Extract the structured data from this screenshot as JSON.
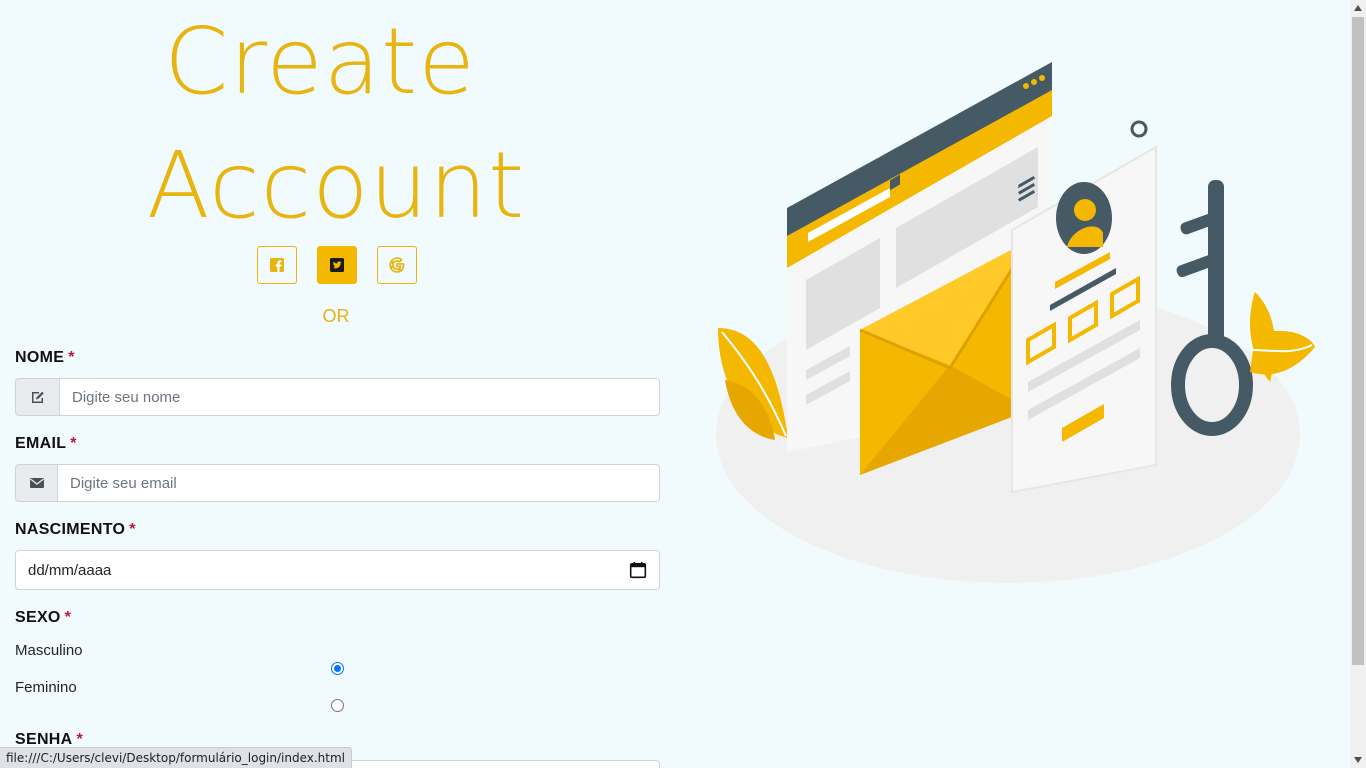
{
  "header": {
    "title_line1": "Create",
    "title_line2": "Account"
  },
  "socials": [
    {
      "name": "facebook",
      "icon": "facebook-icon"
    },
    {
      "name": "twitter",
      "icon": "twitter-icon"
    },
    {
      "name": "google",
      "icon": "google-icon"
    }
  ],
  "or_text": "OR",
  "form": {
    "nome": {
      "label": "NOME",
      "required": "*",
      "placeholder": "Digite seu nome",
      "icon": "pencil-square-icon"
    },
    "email": {
      "label": "EMAIL",
      "required": "*",
      "placeholder": "Digite seu email",
      "icon": "envelope-icon"
    },
    "nascimento": {
      "label": "NASCIMENTO",
      "required": "*",
      "placeholder": "dd/mm/aaaa",
      "icon": "calendar-icon"
    },
    "sexo": {
      "label": "SEXO",
      "required": "*",
      "options": [
        {
          "label": "Masculino",
          "checked": true
        },
        {
          "label": "Feminino",
          "checked": false
        }
      ]
    },
    "senha": {
      "label": "SENHA",
      "required": "*"
    }
  },
  "status_url": "file:///C:/Users/clevi/Desktop/formulário_login/index.html",
  "colors": {
    "accent": "#f5b800",
    "accent_text": "#e8b410",
    "required": "#c0143c",
    "background": "#f1fafc"
  }
}
